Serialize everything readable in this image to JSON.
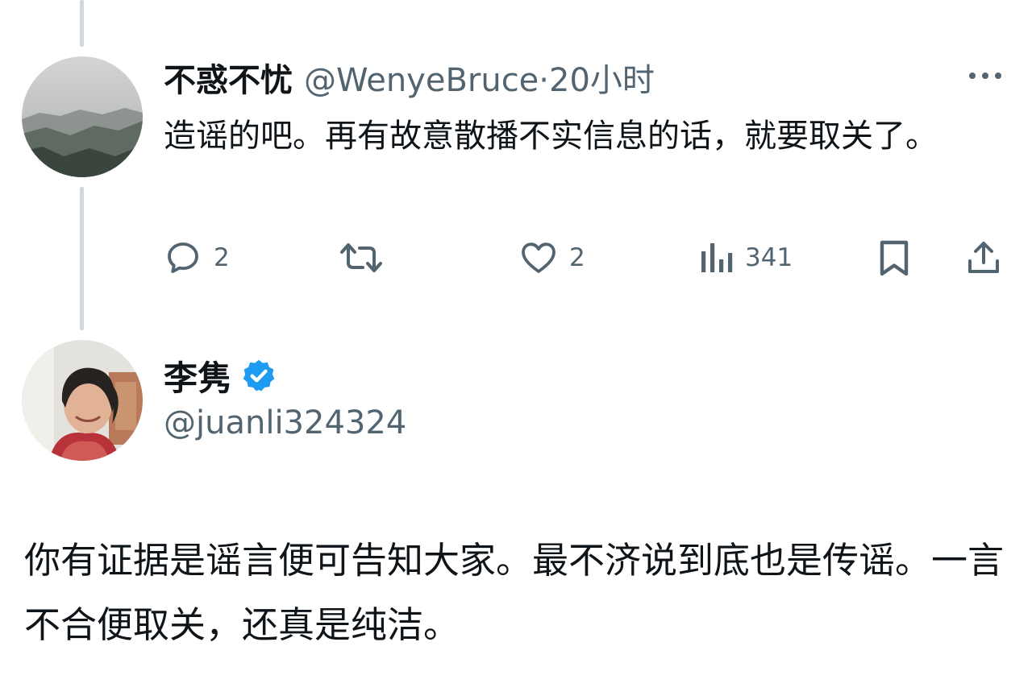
{
  "reply_tweet": {
    "display_name": "不惑不忧",
    "handle_time": "@WenyeBruce·20小时",
    "text": "造谣的吧。再有故意散播不实信息的话，就要取关了。",
    "actions": {
      "reply_count": "2",
      "retweet_count": "",
      "like_count": "2",
      "view_count": "341"
    }
  },
  "main_tweet": {
    "display_name": "李隽",
    "handle": "@juanli324324",
    "text": "你有证据是谣言便可告知大家。最不济说到底也是传谣。一言不合便取关，还真是纯洁。"
  },
  "colors": {
    "text_primary": "#0f1419",
    "text_secondary": "#536471",
    "verified_blue": "#1d9bf0",
    "thread_line": "#cfd9de"
  },
  "icons": {
    "reply": "reply-icon",
    "retweet": "retweet-icon",
    "like": "heart-icon",
    "views": "views-icon",
    "bookmark": "bookmark-icon",
    "share": "share-icon",
    "more": "more-icon",
    "verified": "verified-badge-icon"
  }
}
